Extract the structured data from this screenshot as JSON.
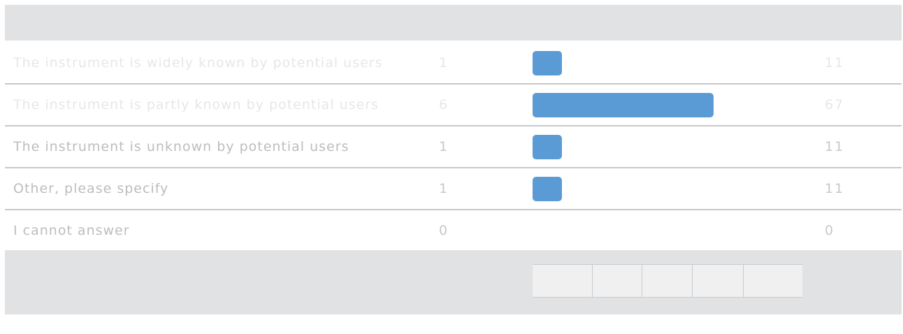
{
  "colors": {
    "bar": "#5b9bd5",
    "label_text_light": "#e6e7e8",
    "label_text": "#bcbdbf",
    "number_text_light": "#e6e7e8",
    "number_text": "#c7c8ca",
    "band": "#e1e2e4"
  },
  "chart_data": {
    "type": "bar",
    "orientation": "horizontal",
    "categories": [
      "The instrument is widely known by potential users",
      "The instrument is partly known by potential users",
      "The instrument is unknown by potential users",
      "Other, please specify",
      "I cannot answer"
    ],
    "counts": [
      1,
      6,
      1,
      1,
      0
    ],
    "percent_labels": [
      "11",
      "67",
      "11",
      "11",
      "0"
    ],
    "values": [
      11,
      67,
      11,
      11,
      0
    ],
    "xlim": [
      0,
      100
    ]
  }
}
